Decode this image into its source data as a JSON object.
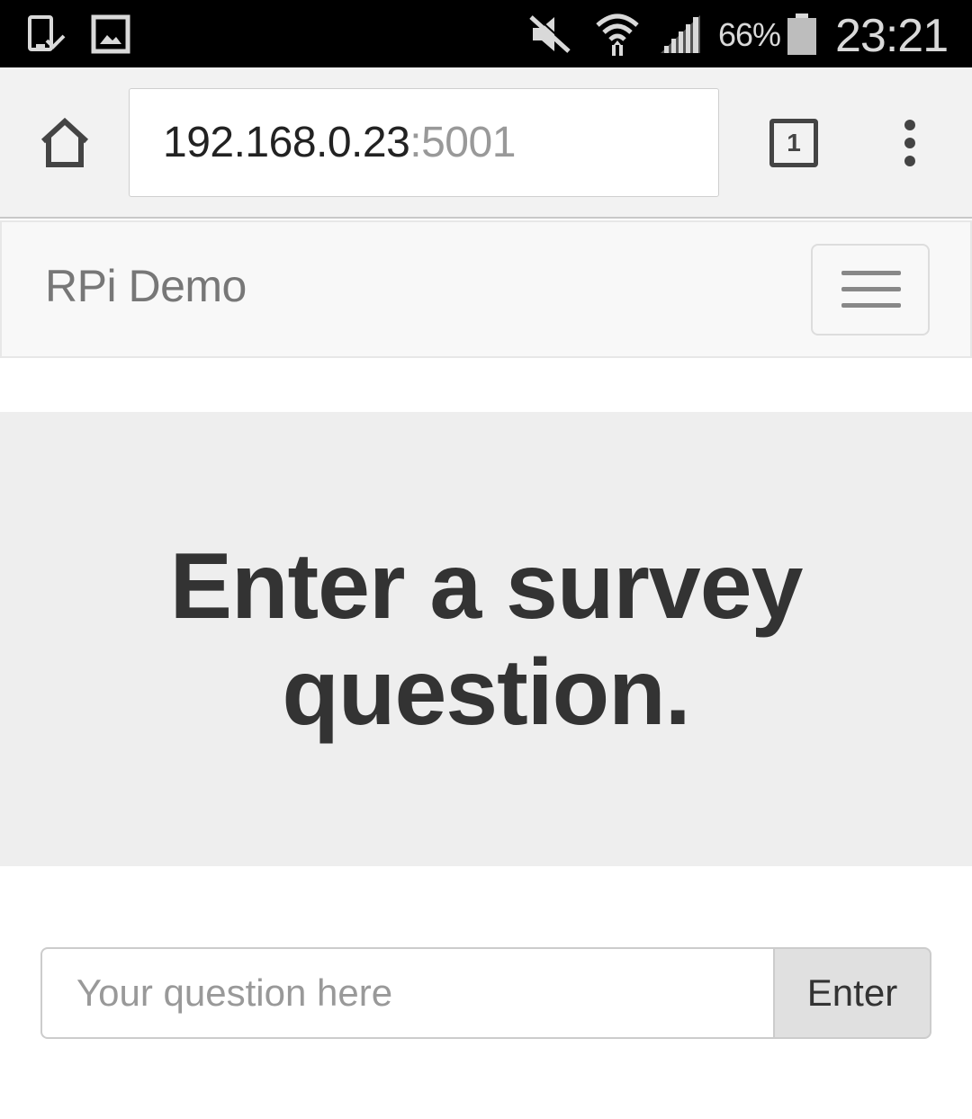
{
  "status_bar": {
    "battery_percent": "66%",
    "clock": "23:21",
    "icons": [
      "screenshot-saved-icon",
      "gallery-icon",
      "mute-icon",
      "wifi-icon",
      "signal-icon",
      "battery-icon"
    ],
    "text_color": "#d9d9d9"
  },
  "browser": {
    "url_host": "192.168.0.23",
    "url_port": ":5001",
    "tab_count": "1"
  },
  "navbar": {
    "brand": "RPi Demo"
  },
  "jumbotron": {
    "heading": "Enter a survey question."
  },
  "form": {
    "placeholder": "Your question here",
    "value": "",
    "submit_label": "Enter"
  },
  "colors": {
    "jumbotron_bg": "#eeeeee",
    "navbar_bg": "#f8f8f8",
    "button_bg": "#e0e0e0"
  }
}
